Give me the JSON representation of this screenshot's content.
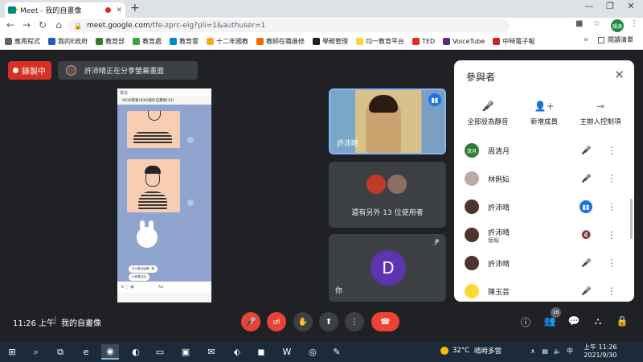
{
  "browser": {
    "tab_title": "Meet - 我的自畫像",
    "tab_close": "✕",
    "new_tab": "+",
    "window_controls": [
      "—",
      "❐",
      "✕"
    ],
    "nav": {
      "back": "←",
      "forward": "→",
      "reload": "↻",
      "home": "⌂"
    },
    "url_host": "meet.google.com",
    "url_path": "/tfe-zprc-eig?pli=1&authuser=1",
    "profile_initials": "陽源",
    "bookmarks": [
      {
        "label": "應用程式",
        "color": "#5f6368"
      },
      {
        "label": "我的E政府",
        "color": "#1e5bb8"
      },
      {
        "label": "教育部",
        "color": "#2e7d32"
      },
      {
        "label": "教育處",
        "color": "#43a047"
      },
      {
        "label": "教育雲",
        "color": "#0288d1"
      },
      {
        "label": "十二年國教",
        "color": "#f9a825"
      },
      {
        "label": "教師在職進修",
        "color": "#ef6c00"
      },
      {
        "label": "學務管理",
        "color": "#212121"
      },
      {
        "label": "均一教育平台",
        "color": "#fdd835"
      },
      {
        "label": "TED",
        "color": "#e62b1e"
      },
      {
        "label": "VoiceTube",
        "color": "#5b2a86"
      },
      {
        "label": "中時電子報",
        "color": "#c62828"
      }
    ],
    "bookmarks_more": "»",
    "reading_list": "閱讀清單"
  },
  "meet": {
    "record_label": "錄製中",
    "presenting_text": "許沛晴正在分享螢幕畫面",
    "shared_screen": {
      "header": "0930畢業(909)我的自畫像(16)",
      "status": "電信",
      "messages": [
        "可以畫出這樣一個",
        "大家要加油"
      ],
      "input_hint": "Aa"
    },
    "tiles": {
      "self_label": "許沛晴",
      "others_label": "還有另外 13 位使用者",
      "you_label": "你",
      "you_avatar_letter": "D"
    },
    "bottom": {
      "time": "11:26 上午",
      "separator": "|",
      "meeting_name": "我的自畫像",
      "participant_count": "16"
    }
  },
  "panel": {
    "title": "參與者",
    "close": "✕",
    "actions": [
      {
        "label": "全部設為靜音",
        "icon": "mic-off-icon"
      },
      {
        "label": "新增成員",
        "icon": "person-add-icon"
      },
      {
        "label": "主辦人控制項",
        "icon": "toggle-icon"
      }
    ],
    "participants": [
      {
        "name": "周清月",
        "sub": "",
        "avatar_text": "清月",
        "avatar_color": "#2e7d32",
        "speaking": false
      },
      {
        "name": "林俐妘",
        "sub": "",
        "avatar_text": "",
        "avatar_color": "#bcaaa4",
        "speaking": false
      },
      {
        "name": "許沛晴",
        "sub": "",
        "avatar_text": "",
        "avatar_color": "#4e342e",
        "speaking": true
      },
      {
        "name": "許沛晴",
        "sub": "簡報",
        "avatar_text": "",
        "avatar_color": "#4e342e",
        "speaking": false
      },
      {
        "name": "許沛晴",
        "sub": "",
        "avatar_text": "",
        "avatar_color": "#4e342e",
        "speaking": false
      },
      {
        "name": "陳玉芸",
        "sub": "",
        "avatar_text": "",
        "avatar_color": "#fdd835",
        "speaking": false
      }
    ]
  },
  "taskbar": {
    "weather_temp": "32°C",
    "weather_text": "晴時多雲",
    "tray_chevron": "∧",
    "ime": "中",
    "clock_time": "上午 11:26",
    "clock_date": "2021/9/30"
  },
  "colors": {
    "meet_bg": "#202124",
    "accent_red": "#ea4335",
    "accent_blue": "#1a73e8",
    "tab_strip": "#dee1e6"
  }
}
